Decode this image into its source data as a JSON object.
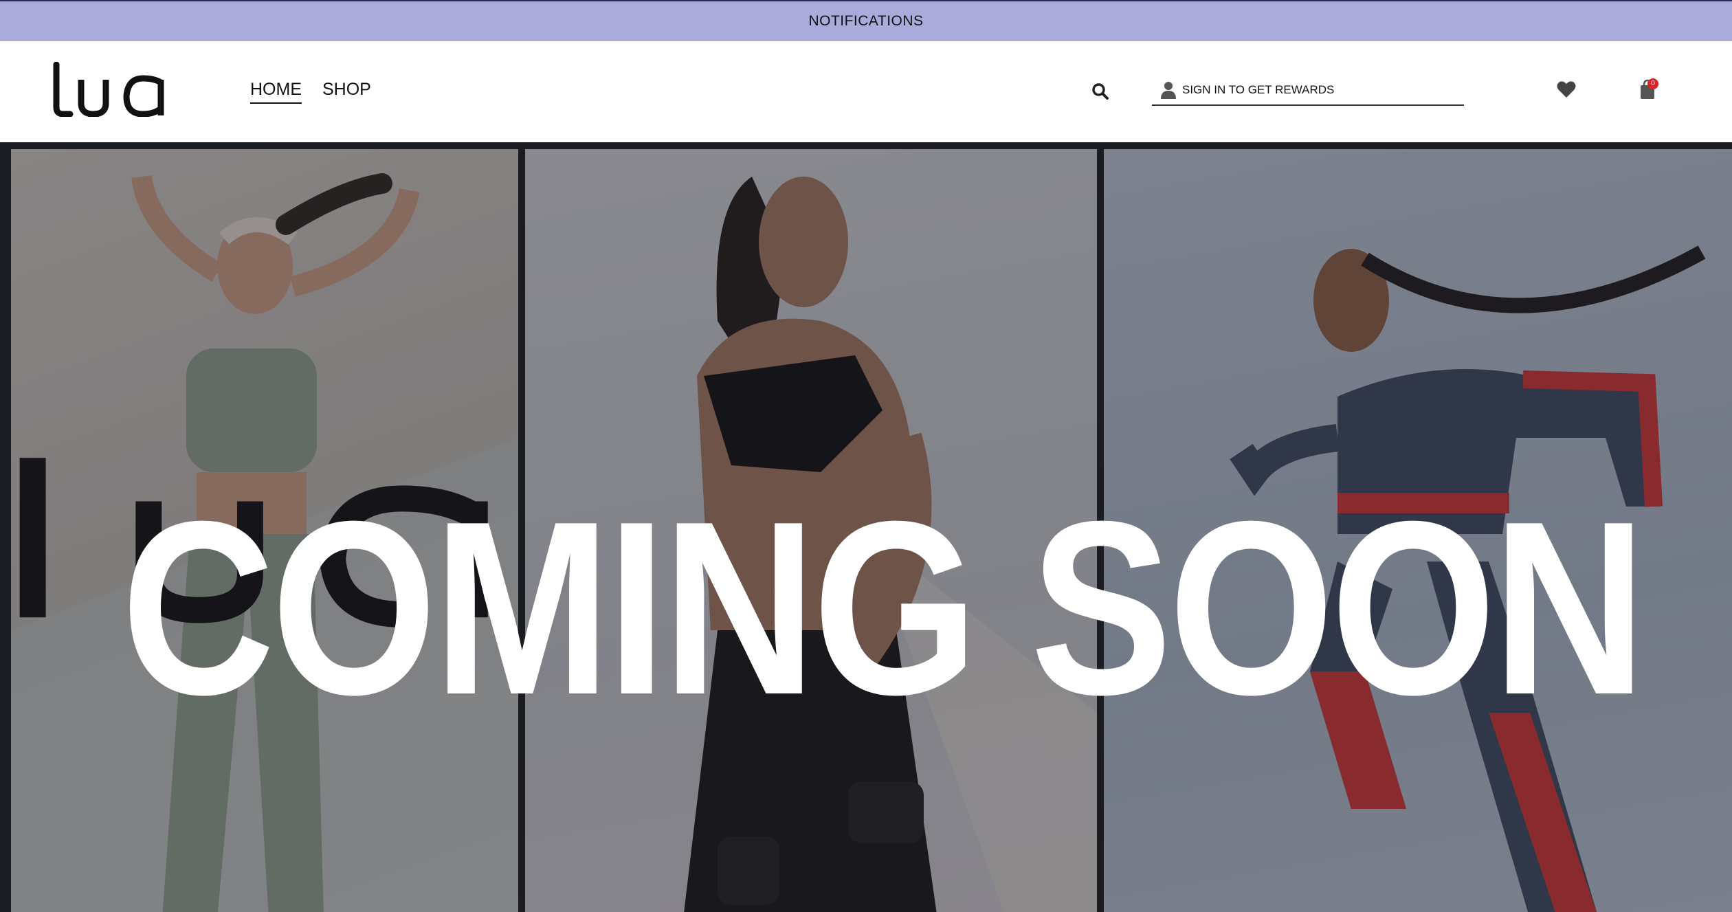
{
  "notification_bar": {
    "label": "NOTIFICATIONS"
  },
  "header": {
    "logo": {
      "text": "LUa",
      "icon": "brand-logo"
    },
    "nav": [
      {
        "label": "HOME",
        "active": true
      },
      {
        "label": "SHOP",
        "active": false
      }
    ],
    "search": {
      "icon": "search-icon"
    },
    "signin": {
      "label": "SIGN IN TO GET REWARDS",
      "icon": "user-icon"
    },
    "wishlist": {
      "icon": "heart-icon"
    },
    "cart": {
      "icon": "cart-icon",
      "count": "0"
    }
  },
  "hero": {
    "headline": "COMING SOON",
    "panels": [
      "woman-tying-hair",
      "woman-with-dumbbells",
      "woman-running"
    ],
    "overlay_color": "#1e1e28"
  },
  "colors": {
    "notification_bg": "#aaaadb",
    "badge": "#dd2222",
    "text": "#111111"
  }
}
